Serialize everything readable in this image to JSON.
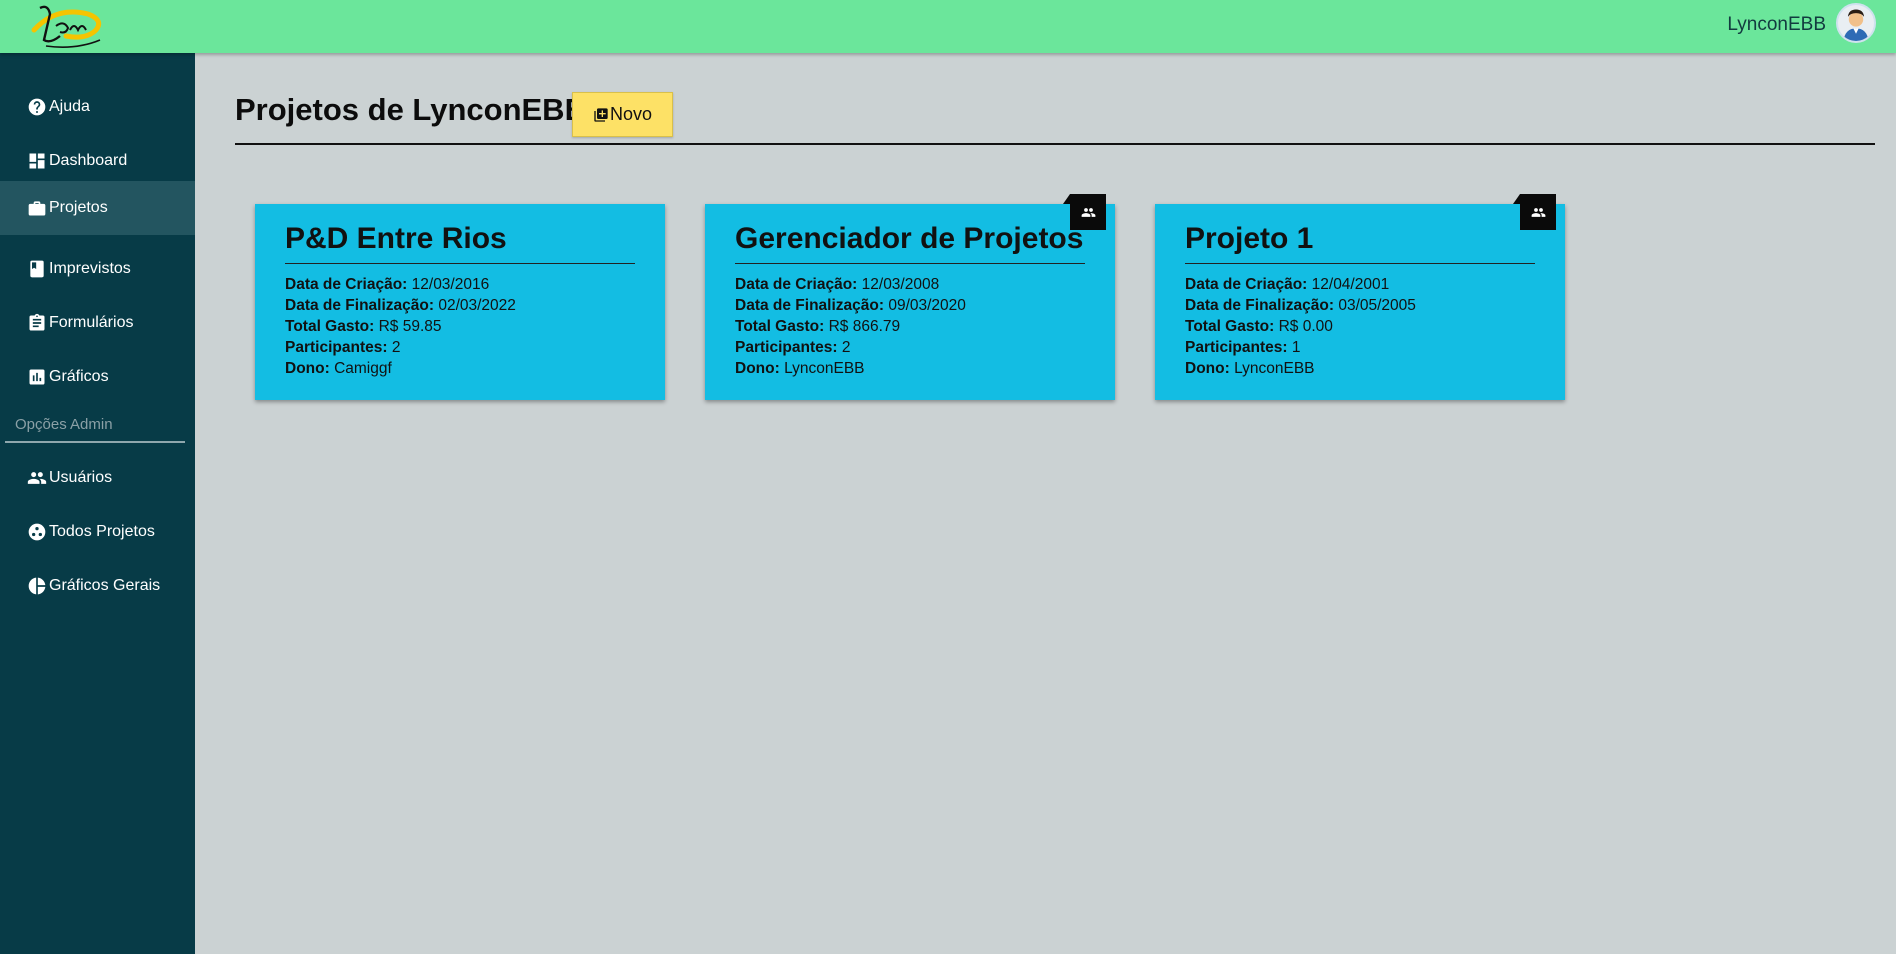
{
  "header": {
    "user_name": "LynconEBB"
  },
  "sidebar": {
    "items": [
      {
        "label": "Ajuda",
        "icon": "help-circle-icon"
      },
      {
        "label": "Dashboard",
        "icon": "dashboard-icon"
      },
      {
        "label": "Projetos",
        "icon": "briefcase-icon",
        "active": true
      },
      {
        "label": "Imprevistos",
        "icon": "book-icon"
      },
      {
        "label": "Formulários",
        "icon": "clipboard-icon"
      },
      {
        "label": "Gráficos",
        "icon": "bar-chart-icon"
      }
    ],
    "admin_label": "Opções Admin",
    "admin_items": [
      {
        "label": "Usuários",
        "icon": "group-icon"
      },
      {
        "label": "Todos Projetos",
        "icon": "projects-circle-icon"
      },
      {
        "label": "Gráficos Gerais",
        "icon": "pie-chart-icon"
      }
    ]
  },
  "main": {
    "title": "Projetos de LynconEBB",
    "new_button_label": "Novo",
    "field_labels": {
      "created": "Data de Criação:",
      "finished": "Data de Finalização:",
      "spent": "Total Gasto:",
      "participants": "Participantes:",
      "owner": "Dono:"
    },
    "projects": [
      {
        "name": "P&D Entre Rios",
        "created": "12/03/2016",
        "finished": "02/03/2022",
        "spent": "R$ 59.85",
        "participants": "2",
        "owner": "Camiggf",
        "shared": false
      },
      {
        "name": "Gerenciador de Projetos",
        "created": "12/03/2008",
        "finished": "09/03/2020",
        "spent": "R$ 866.79",
        "participants": "2",
        "owner": "LynconEBB",
        "shared": true
      },
      {
        "name": "Projeto 1",
        "created": "12/04/2001",
        "finished": "03/05/2005",
        "spent": "R$ 0.00",
        "participants": "1",
        "owner": "LynconEBB",
        "shared": true
      }
    ]
  },
  "colors": {
    "header": "#6be69b",
    "sidebar": "#073b47",
    "sidebar_active": "#235560",
    "card": "#13bde3",
    "button": "#fde166",
    "background": "#cbd2d3"
  }
}
